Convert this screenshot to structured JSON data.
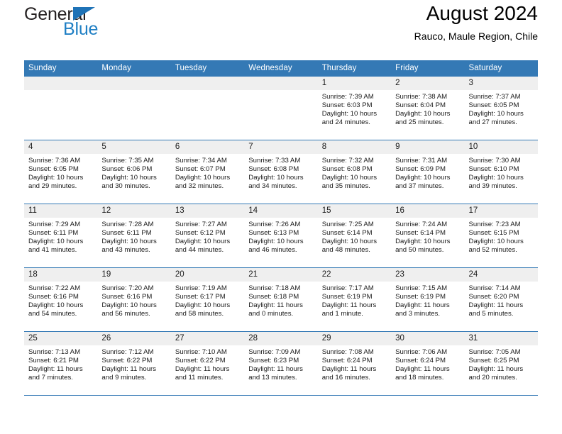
{
  "brand": {
    "name_part1": "General",
    "name_part2": "Blue",
    "accent_color": "#1f7fc4",
    "header_color": "#3479b5"
  },
  "header": {
    "month_title": "August 2024",
    "location": "Rauco, Maule Region, Chile"
  },
  "weekday_headers": [
    "Sunday",
    "Monday",
    "Tuesday",
    "Wednesday",
    "Thursday",
    "Friday",
    "Saturday"
  ],
  "weeks": [
    [
      {
        "day": "",
        "sunrise": "",
        "sunset": "",
        "daylight": "",
        "daylight_cont": "",
        "empty": true
      },
      {
        "day": "",
        "sunrise": "",
        "sunset": "",
        "daylight": "",
        "daylight_cont": "",
        "empty": true
      },
      {
        "day": "",
        "sunrise": "",
        "sunset": "",
        "daylight": "",
        "daylight_cont": "",
        "empty": true
      },
      {
        "day": "",
        "sunrise": "",
        "sunset": "",
        "daylight": "",
        "daylight_cont": "",
        "empty": true
      },
      {
        "day": "1",
        "sunrise": "Sunrise: 7:39 AM",
        "sunset": "Sunset: 6:03 PM",
        "daylight": "Daylight: 10 hours",
        "daylight_cont": "and 24 minutes."
      },
      {
        "day": "2",
        "sunrise": "Sunrise: 7:38 AM",
        "sunset": "Sunset: 6:04 PM",
        "daylight": "Daylight: 10 hours",
        "daylight_cont": "and 25 minutes."
      },
      {
        "day": "3",
        "sunrise": "Sunrise: 7:37 AM",
        "sunset": "Sunset: 6:05 PM",
        "daylight": "Daylight: 10 hours",
        "daylight_cont": "and 27 minutes."
      }
    ],
    [
      {
        "day": "4",
        "sunrise": "Sunrise: 7:36 AM",
        "sunset": "Sunset: 6:05 PM",
        "daylight": "Daylight: 10 hours",
        "daylight_cont": "and 29 minutes."
      },
      {
        "day": "5",
        "sunrise": "Sunrise: 7:35 AM",
        "sunset": "Sunset: 6:06 PM",
        "daylight": "Daylight: 10 hours",
        "daylight_cont": "and 30 minutes."
      },
      {
        "day": "6",
        "sunrise": "Sunrise: 7:34 AM",
        "sunset": "Sunset: 6:07 PM",
        "daylight": "Daylight: 10 hours",
        "daylight_cont": "and 32 minutes."
      },
      {
        "day": "7",
        "sunrise": "Sunrise: 7:33 AM",
        "sunset": "Sunset: 6:08 PM",
        "daylight": "Daylight: 10 hours",
        "daylight_cont": "and 34 minutes."
      },
      {
        "day": "8",
        "sunrise": "Sunrise: 7:32 AM",
        "sunset": "Sunset: 6:08 PM",
        "daylight": "Daylight: 10 hours",
        "daylight_cont": "and 35 minutes."
      },
      {
        "day": "9",
        "sunrise": "Sunrise: 7:31 AM",
        "sunset": "Sunset: 6:09 PM",
        "daylight": "Daylight: 10 hours",
        "daylight_cont": "and 37 minutes."
      },
      {
        "day": "10",
        "sunrise": "Sunrise: 7:30 AM",
        "sunset": "Sunset: 6:10 PM",
        "daylight": "Daylight: 10 hours",
        "daylight_cont": "and 39 minutes."
      }
    ],
    [
      {
        "day": "11",
        "sunrise": "Sunrise: 7:29 AM",
        "sunset": "Sunset: 6:11 PM",
        "daylight": "Daylight: 10 hours",
        "daylight_cont": "and 41 minutes."
      },
      {
        "day": "12",
        "sunrise": "Sunrise: 7:28 AM",
        "sunset": "Sunset: 6:11 PM",
        "daylight": "Daylight: 10 hours",
        "daylight_cont": "and 43 minutes."
      },
      {
        "day": "13",
        "sunrise": "Sunrise: 7:27 AM",
        "sunset": "Sunset: 6:12 PM",
        "daylight": "Daylight: 10 hours",
        "daylight_cont": "and 44 minutes."
      },
      {
        "day": "14",
        "sunrise": "Sunrise: 7:26 AM",
        "sunset": "Sunset: 6:13 PM",
        "daylight": "Daylight: 10 hours",
        "daylight_cont": "and 46 minutes."
      },
      {
        "day": "15",
        "sunrise": "Sunrise: 7:25 AM",
        "sunset": "Sunset: 6:14 PM",
        "daylight": "Daylight: 10 hours",
        "daylight_cont": "and 48 minutes."
      },
      {
        "day": "16",
        "sunrise": "Sunrise: 7:24 AM",
        "sunset": "Sunset: 6:14 PM",
        "daylight": "Daylight: 10 hours",
        "daylight_cont": "and 50 minutes."
      },
      {
        "day": "17",
        "sunrise": "Sunrise: 7:23 AM",
        "sunset": "Sunset: 6:15 PM",
        "daylight": "Daylight: 10 hours",
        "daylight_cont": "and 52 minutes."
      }
    ],
    [
      {
        "day": "18",
        "sunrise": "Sunrise: 7:22 AM",
        "sunset": "Sunset: 6:16 PM",
        "daylight": "Daylight: 10 hours",
        "daylight_cont": "and 54 minutes."
      },
      {
        "day": "19",
        "sunrise": "Sunrise: 7:20 AM",
        "sunset": "Sunset: 6:16 PM",
        "daylight": "Daylight: 10 hours",
        "daylight_cont": "and 56 minutes."
      },
      {
        "day": "20",
        "sunrise": "Sunrise: 7:19 AM",
        "sunset": "Sunset: 6:17 PM",
        "daylight": "Daylight: 10 hours",
        "daylight_cont": "and 58 minutes."
      },
      {
        "day": "21",
        "sunrise": "Sunrise: 7:18 AM",
        "sunset": "Sunset: 6:18 PM",
        "daylight": "Daylight: 11 hours",
        "daylight_cont": "and 0 minutes."
      },
      {
        "day": "22",
        "sunrise": "Sunrise: 7:17 AM",
        "sunset": "Sunset: 6:19 PM",
        "daylight": "Daylight: 11 hours",
        "daylight_cont": "and 1 minute."
      },
      {
        "day": "23",
        "sunrise": "Sunrise: 7:15 AM",
        "sunset": "Sunset: 6:19 PM",
        "daylight": "Daylight: 11 hours",
        "daylight_cont": "and 3 minutes."
      },
      {
        "day": "24",
        "sunrise": "Sunrise: 7:14 AM",
        "sunset": "Sunset: 6:20 PM",
        "daylight": "Daylight: 11 hours",
        "daylight_cont": "and 5 minutes."
      }
    ],
    [
      {
        "day": "25",
        "sunrise": "Sunrise: 7:13 AM",
        "sunset": "Sunset: 6:21 PM",
        "daylight": "Daylight: 11 hours",
        "daylight_cont": "and 7 minutes."
      },
      {
        "day": "26",
        "sunrise": "Sunrise: 7:12 AM",
        "sunset": "Sunset: 6:22 PM",
        "daylight": "Daylight: 11 hours",
        "daylight_cont": "and 9 minutes."
      },
      {
        "day": "27",
        "sunrise": "Sunrise: 7:10 AM",
        "sunset": "Sunset: 6:22 PM",
        "daylight": "Daylight: 11 hours",
        "daylight_cont": "and 11 minutes."
      },
      {
        "day": "28",
        "sunrise": "Sunrise: 7:09 AM",
        "sunset": "Sunset: 6:23 PM",
        "daylight": "Daylight: 11 hours",
        "daylight_cont": "and 13 minutes."
      },
      {
        "day": "29",
        "sunrise": "Sunrise: 7:08 AM",
        "sunset": "Sunset: 6:24 PM",
        "daylight": "Daylight: 11 hours",
        "daylight_cont": "and 16 minutes."
      },
      {
        "day": "30",
        "sunrise": "Sunrise: 7:06 AM",
        "sunset": "Sunset: 6:24 PM",
        "daylight": "Daylight: 11 hours",
        "daylight_cont": "and 18 minutes."
      },
      {
        "day": "31",
        "sunrise": "Sunrise: 7:05 AM",
        "sunset": "Sunset: 6:25 PM",
        "daylight": "Daylight: 11 hours",
        "daylight_cont": "and 20 minutes."
      }
    ]
  ]
}
